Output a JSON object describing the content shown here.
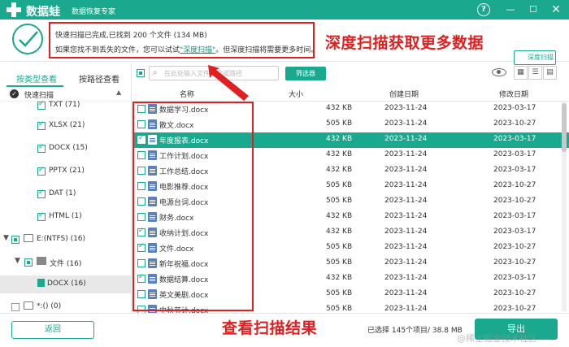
{
  "app": {
    "name": "数据蛙",
    "subtitle": "数据恢复专家",
    "help_label": "?",
    "minimize_label": "—",
    "maximize_label": "☐",
    "close_label": "✕"
  },
  "status": {
    "line1": "快速扫描已完成,已找到 200 个文件 (134 MB)",
    "line2_prefix": "如果您找不到丢失的文件，您可以试试",
    "line2_link": "\"深度扫描\"",
    "line2_suffix": "。但深度扫描将需要更多时间。",
    "deep_scan_button": "深度扫描"
  },
  "annotations": {
    "top": "深度扫描获取更多数据",
    "bottom": "查看扫描结果"
  },
  "sidebar": {
    "tabs": [
      "按类型查看",
      "按路径查看"
    ],
    "quick_scan": "快速扫描",
    "items": [
      {
        "label": "TXT (71)"
      },
      {
        "label": "XLSX (21)"
      },
      {
        "label": "DOCX (15)"
      },
      {
        "label": "PPTX (21)"
      },
      {
        "label": "DAT (1)"
      },
      {
        "label": "HTML (1)"
      },
      {
        "label": "E:(NTFS) (16)"
      },
      {
        "label": "文件 (16)"
      },
      {
        "label": "DOCX (16)"
      },
      {
        "label": "*:() (0)"
      }
    ]
  },
  "toolbar": {
    "search_placeholder": "在此处输入文件名称或路径",
    "filter_button": "筛选器"
  },
  "table": {
    "headers": {
      "name": "名称",
      "size": "大小",
      "created": "创建日期",
      "modified": "修改日期"
    },
    "rows": [
      {
        "name": "数据学习.docx",
        "size": "432 KB",
        "created": "2023-11-24",
        "modified": "2023-03-17",
        "checked": false,
        "selected": false
      },
      {
        "name": "散文.docx",
        "size": "505 KB",
        "created": "2023-11-24",
        "modified": "2023-10-27",
        "checked": false,
        "selected": false
      },
      {
        "name": "年度报表.docx",
        "size": "432 KB",
        "created": "2023-11-24",
        "modified": "2023-03-17",
        "checked": true,
        "selected": true
      },
      {
        "name": "工作计划.docx",
        "size": "432 KB",
        "created": "2023-11-24",
        "modified": "2023-03-17",
        "checked": false,
        "selected": false
      },
      {
        "name": "工作总结.docx",
        "size": "432 KB",
        "created": "2023-11-24",
        "modified": "2023-03-17",
        "checked": false,
        "selected": false
      },
      {
        "name": "电影推荐.docx",
        "size": "505 KB",
        "created": "2023-11-24",
        "modified": "2023-10-27",
        "checked": false,
        "selected": false
      },
      {
        "name": "电源台词.docx",
        "size": "505 KB",
        "created": "2023-11-24",
        "modified": "2023-10-27",
        "checked": false,
        "selected": false
      },
      {
        "name": "财务.docx",
        "size": "432 KB",
        "created": "2023-11-24",
        "modified": "2023-03-17",
        "checked": false,
        "selected": false
      },
      {
        "name": "收纳计划.docx",
        "size": "432 KB",
        "created": "2023-11-24",
        "modified": "2023-03-17",
        "checked": true,
        "selected": false
      },
      {
        "name": "文件.docx",
        "size": "505 KB",
        "created": "2023-11-24",
        "modified": "2023-10-27",
        "checked": true,
        "selected": false
      },
      {
        "name": "新年祝福.docx",
        "size": "505 KB",
        "created": "2023-11-24",
        "modified": "2023-10-27",
        "checked": false,
        "selected": false
      },
      {
        "name": "数据结算.docx",
        "size": "432 KB",
        "created": "2023-11-24",
        "modified": "2023-03-17",
        "checked": true,
        "selected": false
      },
      {
        "name": "英文美剧.docx",
        "size": "505 KB",
        "created": "2023-11-24",
        "modified": "2023-10-27",
        "checked": false,
        "selected": false
      },
      {
        "name": "中秋节计.docx",
        "size": "505 KB",
        "created": "2023-11-24",
        "modified": "2023-10-27",
        "checked": false,
        "selected": false
      }
    ]
  },
  "footer": {
    "back_button": "返回",
    "selected_count": "已选择 145个项目/ 38.8 MB",
    "export_button": "导出",
    "watermark": "@稀土掘金技术社区"
  },
  "colors": {
    "accent": "#1aa88e",
    "annotation": "#e02020"
  }
}
